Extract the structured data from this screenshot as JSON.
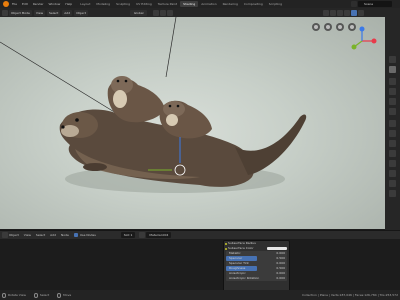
{
  "topbar": {
    "menus": [
      "File",
      "Edit",
      "Render",
      "Window",
      "Help"
    ],
    "workspaces": [
      "Layout",
      "Modeling",
      "Sculpting",
      "UV Editing",
      "Texture Paint",
      "Shading",
      "Animation",
      "Rendering",
      "Compositing",
      "Scripting"
    ],
    "active_workspace": "Shading",
    "scene": "Scene"
  },
  "viewport_header": {
    "mode": "Object Mode",
    "view": "View",
    "select": "Select",
    "add": "Add",
    "object": "Object",
    "orientation": "Global"
  },
  "node_editor": {
    "header": {
      "object": "Object",
      "view": "View",
      "select": "Select",
      "add": "Add",
      "node": "Node",
      "use_nodes": "Use Nodes",
      "slot": "Slot 1",
      "material": "Material.004"
    },
    "node": {
      "rows": [
        {
          "label": "Subsurface Radius",
          "type": "socket"
        },
        {
          "label": "Subsurface Color",
          "type": "swatch"
        },
        {
          "label": "Metallic",
          "type": "bar",
          "value": "0.000",
          "fill": 0.0
        },
        {
          "label": "Specular",
          "type": "bar",
          "value": "0.500",
          "fill": 0.5
        },
        {
          "label": "Specular Tint",
          "type": "bar",
          "value": "0.000",
          "fill": 0.0
        },
        {
          "label": "Roughness",
          "type": "bar",
          "value": "0.500",
          "fill": 0.5
        },
        {
          "label": "Anisotropic",
          "type": "bar",
          "value": "0.000",
          "fill": 0.0
        },
        {
          "label": "Anisotropic Rotation",
          "type": "bar",
          "value": "0.000",
          "fill": 0.0
        }
      ]
    }
  },
  "statusbar": {
    "rotate": "Rotate View",
    "select": "Select",
    "move": "Move",
    "stats": "Collection | Plane | Verts:187,046 | Faces:126,784 | Tris:253,572"
  },
  "colors": {
    "accent": "#4772b3",
    "blender_orange": "#e87d0d",
    "x_axis": "#e83a4a",
    "y_axis": "#7ab32a",
    "z_axis": "#3b79e8"
  }
}
